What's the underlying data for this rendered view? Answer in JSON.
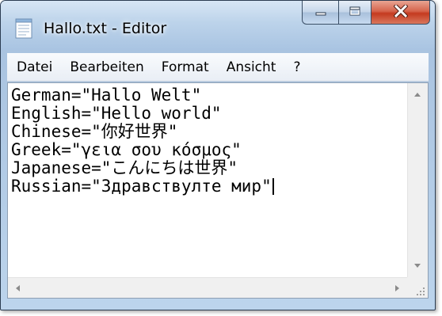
{
  "window": {
    "title": "Hallo.txt - Editor",
    "accent": "#a9c4e2",
    "close_color": "#c43a1f"
  },
  "icons": {
    "app": "notepad-icon",
    "minimize": "minimize-icon",
    "maximize": "maximize-icon",
    "close": "close-icon"
  },
  "menu": {
    "items": [
      {
        "label": "Datei"
      },
      {
        "label": "Bearbeiten"
      },
      {
        "label": "Format"
      },
      {
        "label": "Ansicht"
      },
      {
        "label": "?"
      }
    ]
  },
  "editor": {
    "lines": [
      {
        "text": "German=\"Hallo Welt\""
      },
      {
        "text": "English=\"Hello world\""
      },
      {
        "text": "Chinese=\"你好世界\""
      },
      {
        "text": "Greek=\"γεια σου κόσμος\""
      },
      {
        "text": "Japanese=\"こんにちは世界\""
      },
      {
        "text": "Russian=\"Здравствулте мир\""
      }
    ]
  }
}
